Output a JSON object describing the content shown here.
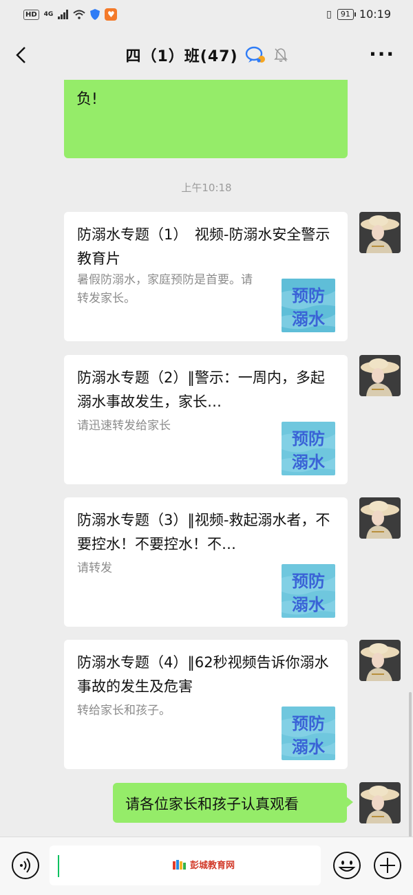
{
  "status_bar": {
    "hd": "HD",
    "network": "4G",
    "battery": "91",
    "time": "10:19"
  },
  "header": {
    "title": "四（1）班(47)"
  },
  "messages": {
    "top_partial_text": "负!",
    "timestamp": "上午10:18",
    "cards": [
      {
        "title": "防溺水专题（1）　视频-防溺水安全警示教育片",
        "description": "暑假防溺水，家庭预防是首要。请转发家长。",
        "thumb_text_top": "预防",
        "thumb_text_bottom": "溺水"
      },
      {
        "title": "防溺水专题（2）‖警示：一周内，多起溺水事故发生，家长…",
        "description": "请迅速转发给家长",
        "thumb_text_top": "预防",
        "thumb_text_bottom": "溺水"
      },
      {
        "title": "防溺水专题（3）‖视频-救起溺水者，不要控水！不要控水！不…",
        "description": "请转发",
        "thumb_text_top": "预防",
        "thumb_text_bottom": "溺水"
      },
      {
        "title": "防溺水专题（4）‖62秒视频告诉你溺水事故的发生及危害",
        "description": "转给家长和孩子。",
        "thumb_text_top": "预防",
        "thumb_text_bottom": "溺水"
      }
    ],
    "reply_text": "请各位家长和孩子认真观看"
  },
  "input_bar": {
    "watermark": "彭城教育网"
  },
  "colors": {
    "bubble_green": "#95ec69",
    "background": "#ededed",
    "thumb_blue": "#3a63d6"
  }
}
